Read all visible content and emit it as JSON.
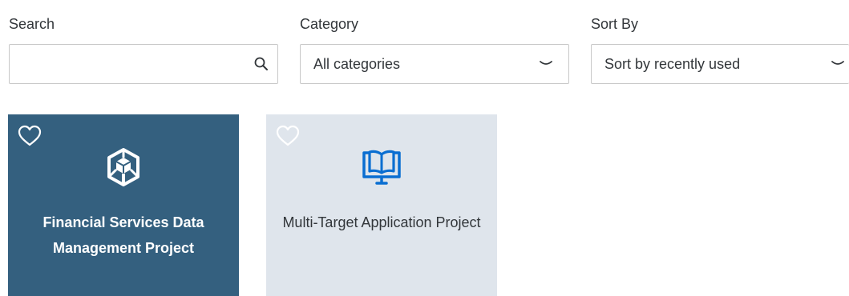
{
  "filters": {
    "search": {
      "label": "Search",
      "value": "",
      "placeholder": ""
    },
    "category": {
      "label": "Category",
      "selected": "All categories"
    },
    "sort": {
      "label": "Sort By",
      "selected": "Sort by recently used"
    }
  },
  "tiles": [
    {
      "title": "Financial Services Data Management Project",
      "icon": "cubes-icon",
      "favorite_icon": "heart-outline-icon",
      "selected": true
    },
    {
      "title": "Multi-Target Application Project",
      "icon": "book-monitor-icon",
      "favorite_icon": "heart-outline-icon",
      "selected": false
    }
  ],
  "colors": {
    "selected_tile_bg": "#34607f",
    "tile_bg": "#dfe5ec",
    "accent": "#0a6ed1",
    "border": "#c8c8c8"
  }
}
